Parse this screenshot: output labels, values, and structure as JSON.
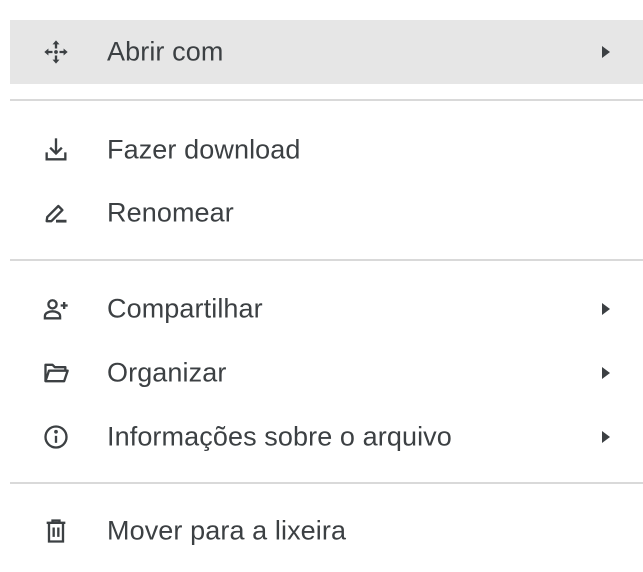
{
  "menu": {
    "items": [
      {
        "label": "Abrir com",
        "icon": "open-with-icon",
        "has_submenu": true,
        "highlighted": true
      },
      {
        "label": "Fazer download",
        "icon": "download-icon",
        "has_submenu": false
      },
      {
        "label": "Renomear",
        "icon": "rename-icon",
        "has_submenu": false
      },
      {
        "label": "Compartilhar",
        "icon": "share-person-add-icon",
        "has_submenu": true
      },
      {
        "label": "Organizar",
        "icon": "folder-open-icon",
        "has_submenu": true
      },
      {
        "label": "Informações sobre o arquivo",
        "icon": "info-icon",
        "has_submenu": true
      },
      {
        "label": "Mover para a lixeira",
        "icon": "trash-icon",
        "has_submenu": false
      }
    ]
  },
  "colors": {
    "text": "#3c4043",
    "highlight": "#e6e6e6",
    "divider": "#d9d9d9",
    "background": "#ffffff"
  }
}
